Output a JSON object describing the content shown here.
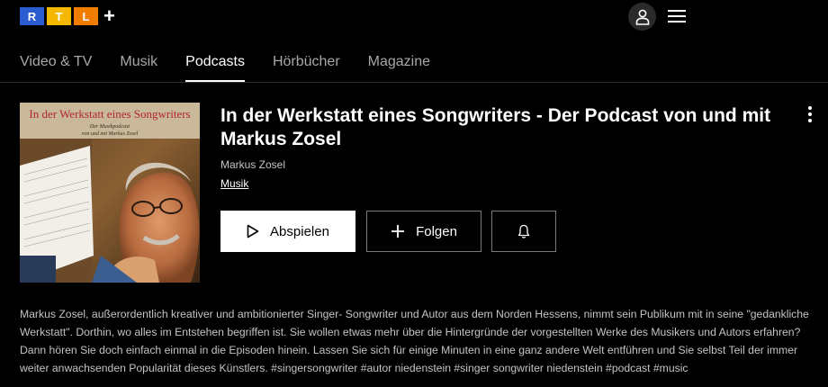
{
  "brand": {
    "letters": [
      "R",
      "T",
      "L"
    ],
    "colors": [
      "#2a5ccf",
      "#f5b800",
      "#f07d00"
    ],
    "plus": "+"
  },
  "header": {
    "user_icon": "user-icon",
    "menu_icon": "hamburger-menu-icon"
  },
  "nav": {
    "tabs": [
      {
        "label": "Video & TV",
        "active": false
      },
      {
        "label": "Musik",
        "active": false
      },
      {
        "label": "Podcasts",
        "active": true
      },
      {
        "label": "Hörbücher",
        "active": false
      },
      {
        "label": "Magazine",
        "active": false
      }
    ]
  },
  "podcast": {
    "cover_title": "In der Werkstatt eines Songwriters",
    "cover_subtitle_1": "Der Musikpodcast",
    "cover_subtitle_2": "von und mit Markus Zosel",
    "title": "In der Werkstatt eines Songwriters - Der Podcast von und mit Markus Zosel",
    "author": "Markus Zosel",
    "category": "Musik",
    "play_label": "Abspielen",
    "follow_label": "Folgen",
    "description": "Markus Zosel, außerordentlich kreativer und ambitionierter Singer- Songwriter und Autor aus dem Norden Hessens, nimmt sein Publikum mit in seine \"gedankliche Werkstatt\". Dorthin, wo alles im Entstehen begriffen ist. Sie wollen etwas mehr über die Hintergründe der vorgestellten Werke des Musikers und Autors erfahren? Dann hören Sie doch einfach einmal in die Episoden hinein. Lassen Sie sich für einige Minuten in eine ganz andere Welt entführen und Sie selbst Teil der immer weiter anwachsenden Popularität dieses Künstlers. #singersongwriter #autor niedenstein #singer songwriter niedenstein #podcast #music"
  }
}
